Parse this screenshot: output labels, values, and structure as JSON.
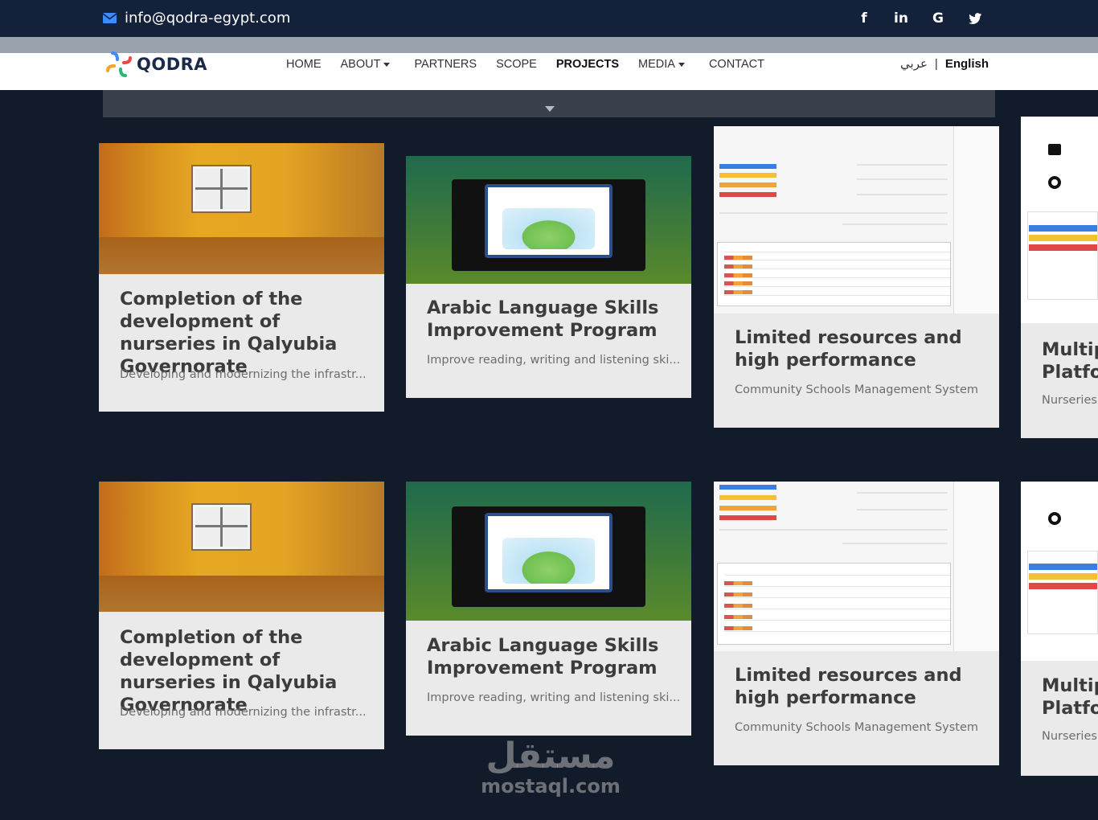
{
  "topbar": {
    "email": "info@qodra-egypt.com",
    "social_icons": [
      "facebook-icon",
      "linkedin-icon",
      "google-icon",
      "twitter-icon"
    ],
    "social_glyphs": [
      "f",
      "in",
      "G",
      "t"
    ]
  },
  "navbar": {
    "logo_text": "QODRA",
    "items": [
      "HOME",
      "ABOUT",
      "PARTNERS",
      "SCOPE",
      "PROJECTS",
      "MEDIA",
      "CONTACT"
    ],
    "active": "PROJECTS",
    "lang_ar": "عربي",
    "lang_sep": "|",
    "lang_en": "English"
  },
  "cards": [
    {
      "title": "Completion of the development of nurseries in Qalyubia Governorate",
      "desc": "Developing and modernizing the infrastr..."
    },
    {
      "title": "Arabic Language Skills Improvement Program",
      "desc": "Improve reading, writing and listening ski..."
    },
    {
      "title": "Limited resources and high performance",
      "desc": "Community Schools Management System"
    },
    {
      "title": "Multip Platfor",
      "title_line1": "Multip",
      "title_line2": "Platfor",
      "desc": "Nurseries"
    }
  ],
  "watermark": {
    "arabic": "مستقل",
    "latin": "mostaql.com"
  }
}
